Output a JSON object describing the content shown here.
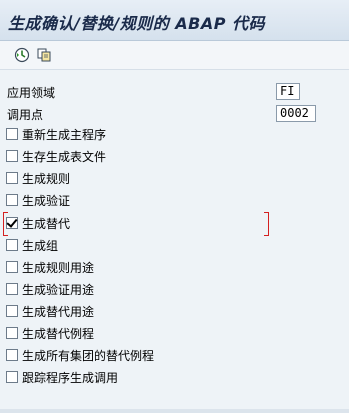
{
  "window": {
    "title": "生成确认/替换/规则的 ABAP 代码"
  },
  "toolbar": {
    "execute_icon": "execute-clock-icon",
    "variant_icon": "copy-variant-icon"
  },
  "fields": {
    "application_area": {
      "label": "应用领域",
      "value": "FI"
    },
    "callup_point": {
      "label": "调用点",
      "value": "0002"
    }
  },
  "options": [
    {
      "label": "重新生成主程序",
      "checked": false
    },
    {
      "label": "生存生成表文件",
      "checked": false
    },
    {
      "label": "生成规则",
      "checked": false
    },
    {
      "label": "生成验证",
      "checked": false
    },
    {
      "label": "生成替代",
      "checked": true
    },
    {
      "label": "生成组",
      "checked": false
    },
    {
      "label": "生成规则用途",
      "checked": false
    },
    {
      "label": "生成验证用途",
      "checked": false
    },
    {
      "label": "生成替代用途",
      "checked": false
    },
    {
      "label": "生成替代例程",
      "checked": false
    },
    {
      "label": "生成所有集团的替代例程",
      "checked": false
    },
    {
      "label": "跟踪程序生成调用",
      "checked": false
    }
  ]
}
